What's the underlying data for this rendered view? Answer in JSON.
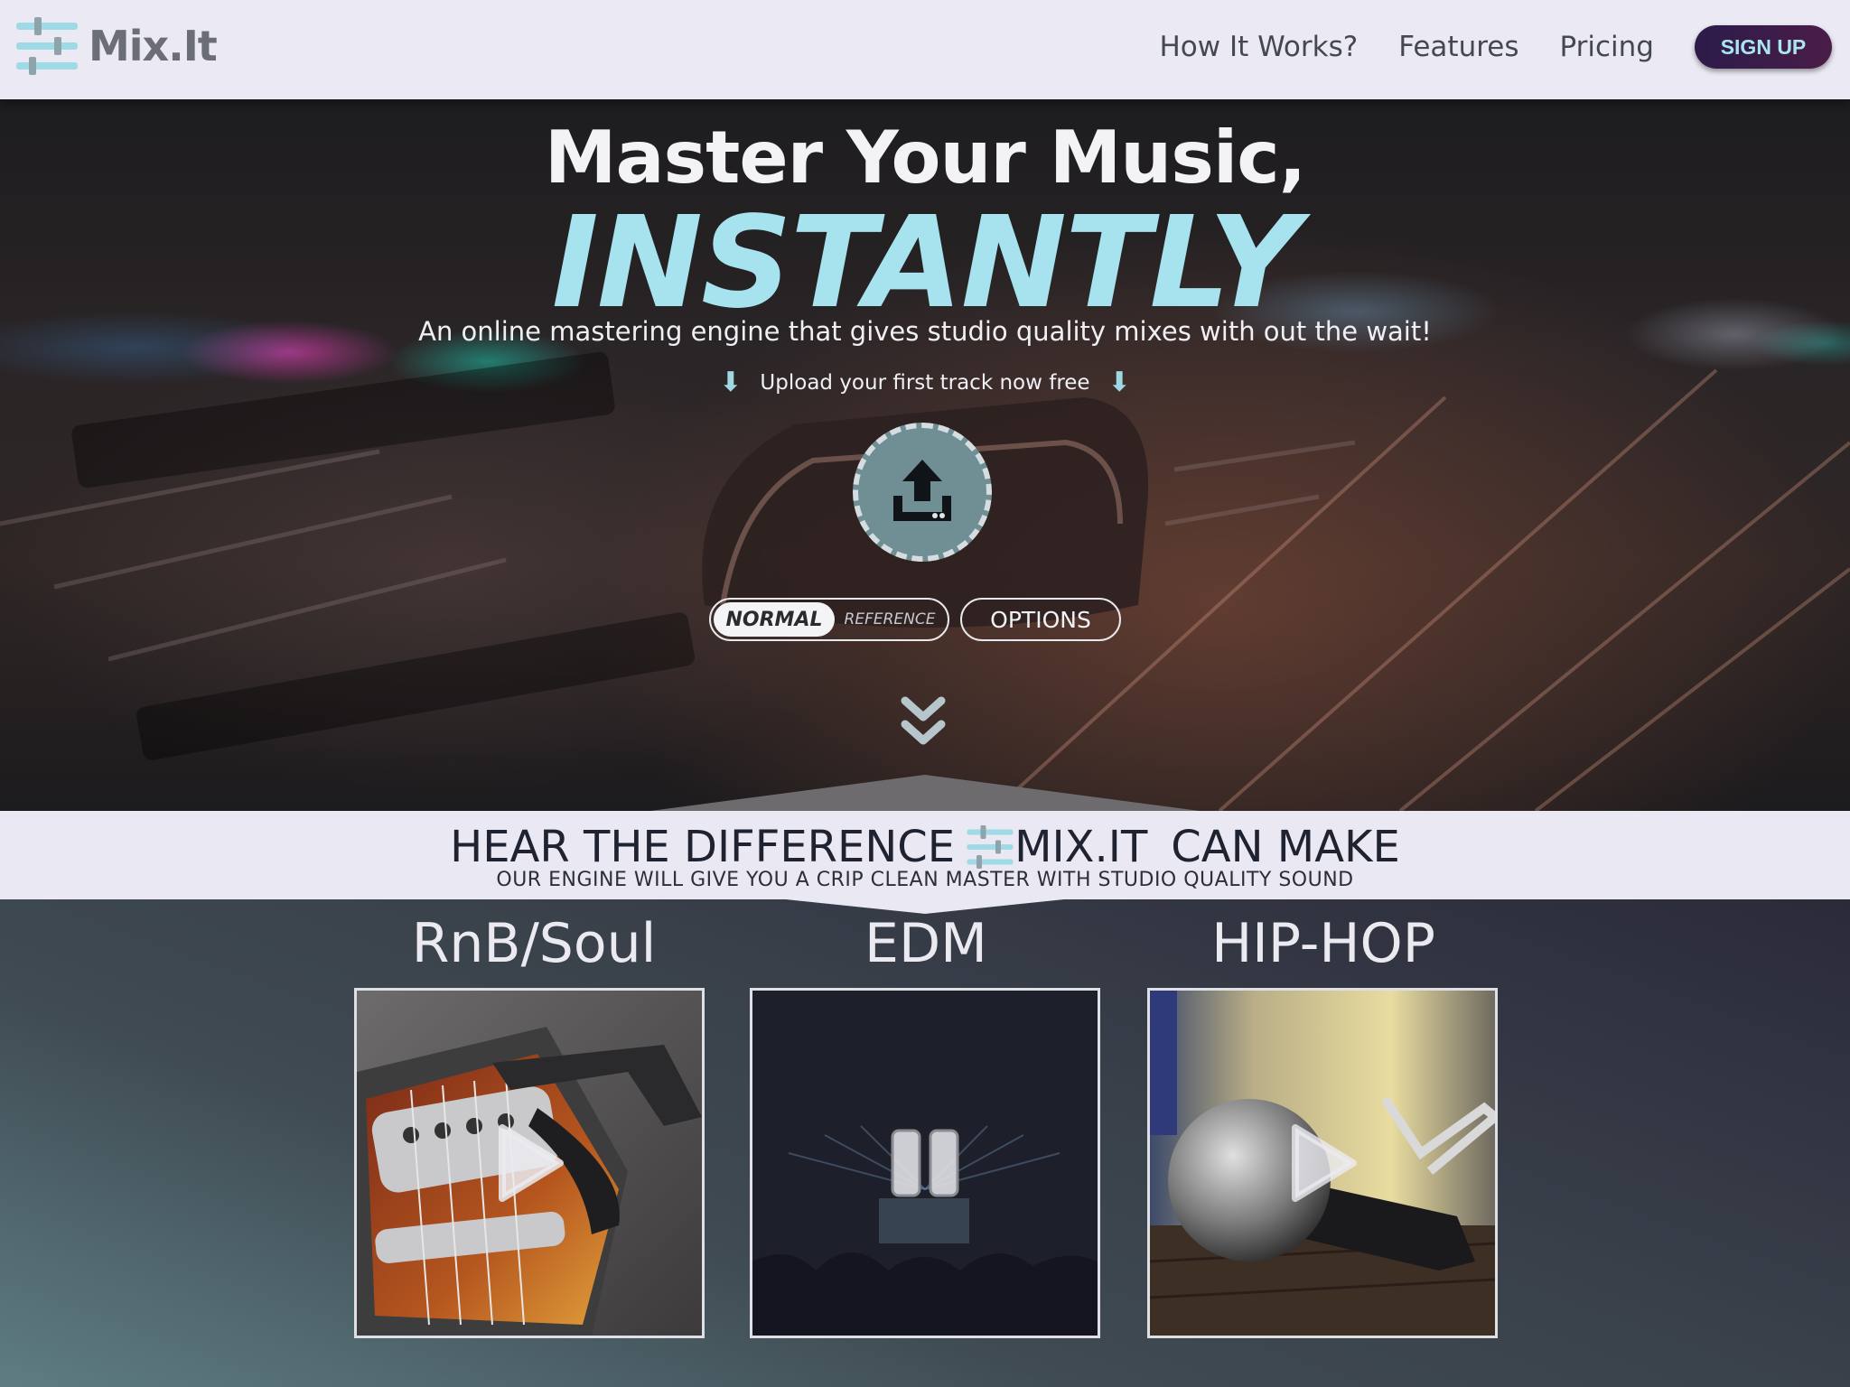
{
  "brand": {
    "name": "Mix.It"
  },
  "nav": {
    "links": [
      "How It Works?",
      "Features",
      "Pricing"
    ],
    "signup_label": "SIGN UP"
  },
  "hero": {
    "title": "Master Your Music,",
    "emphasis": "INSTANTLY",
    "subtitle": "An online mastering engine that gives studio quality mixes with out the wait!",
    "upload_hint": "Upload your first track now free",
    "mode_toggle": {
      "options": [
        "NORMAL",
        "REFERENCE"
      ],
      "selected": "NORMAL"
    },
    "options_label": "OPTIONS"
  },
  "section": {
    "title_before": "HEAR THE DIFFERENCE",
    "title_brand": "MIX.IT",
    "title_after": "CAN MAKE",
    "subtitle": "OUR ENGINE WILL GIVE YOU A CRIP CLEAN MASTER WITH STUDIO QUALITY SOUND"
  },
  "genres": [
    {
      "label": "RnB/Soul",
      "state": "play"
    },
    {
      "label": "EDM",
      "state": "pause"
    },
    {
      "label": "HIP-HOP",
      "state": "play"
    }
  ],
  "colors": {
    "accent": "#a7e3ef",
    "signup_bg": "#3a1c4a",
    "nav_bg": "#ebeaf4"
  }
}
